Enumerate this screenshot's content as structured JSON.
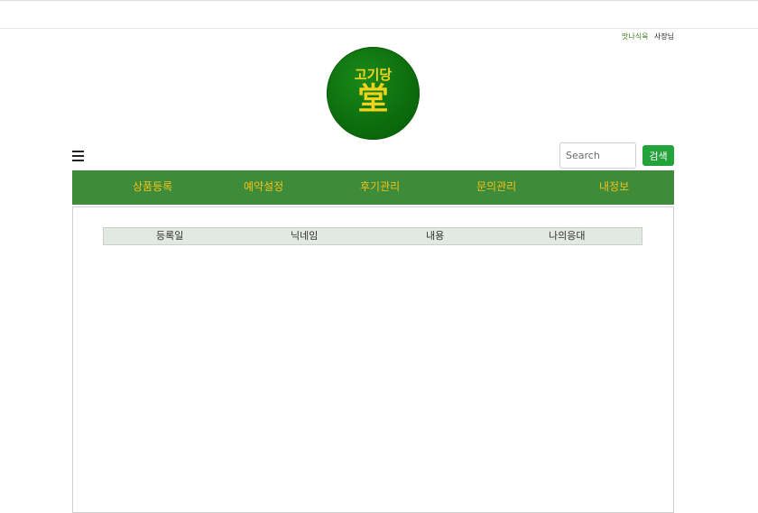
{
  "header": {
    "brand_link": "맛나식육",
    "owner_label": "사장님"
  },
  "logo": {
    "line1": "고기당",
    "line2": "堂"
  },
  "toolbar": {
    "menu_icon": "hamburger-menu-icon",
    "search_placeholder": "Search",
    "search_button_label": "검색"
  },
  "nav": {
    "items": [
      {
        "label": "상품등록"
      },
      {
        "label": "예약설정"
      },
      {
        "label": "후기관리"
      },
      {
        "label": "문의관리"
      },
      {
        "label": "내정보"
      }
    ]
  },
  "table": {
    "columns": [
      "등록일",
      "닉네임",
      "내용",
      "나의응대"
    ]
  },
  "colors": {
    "nav_background": "#3e8b3a",
    "nav_text": "#f3c21b",
    "search_button": "#23a33a",
    "logo_green": "#0d6e0d",
    "logo_gold": "#f2d21a",
    "table_header_bg": "#e2e8e2"
  }
}
